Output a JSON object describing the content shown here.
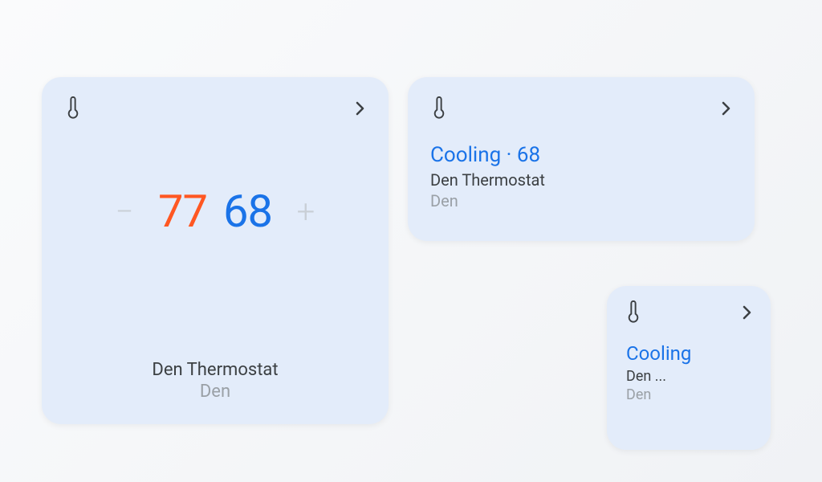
{
  "colors": {
    "heat": "#ff5722",
    "cool": "#1a73e8",
    "card_bg": "#e3ecfa",
    "muted": "#9aa0a6"
  },
  "large_card": {
    "heat_setpoint": "77",
    "cool_setpoint": "68",
    "device_name": "Den Thermostat",
    "room": "Den"
  },
  "medium_card": {
    "status_line": "Cooling · 68",
    "device_name": "Den Thermostat",
    "room": "Den"
  },
  "small_card": {
    "status": "Cooling",
    "device_name": "Den ...",
    "room": "Den"
  }
}
